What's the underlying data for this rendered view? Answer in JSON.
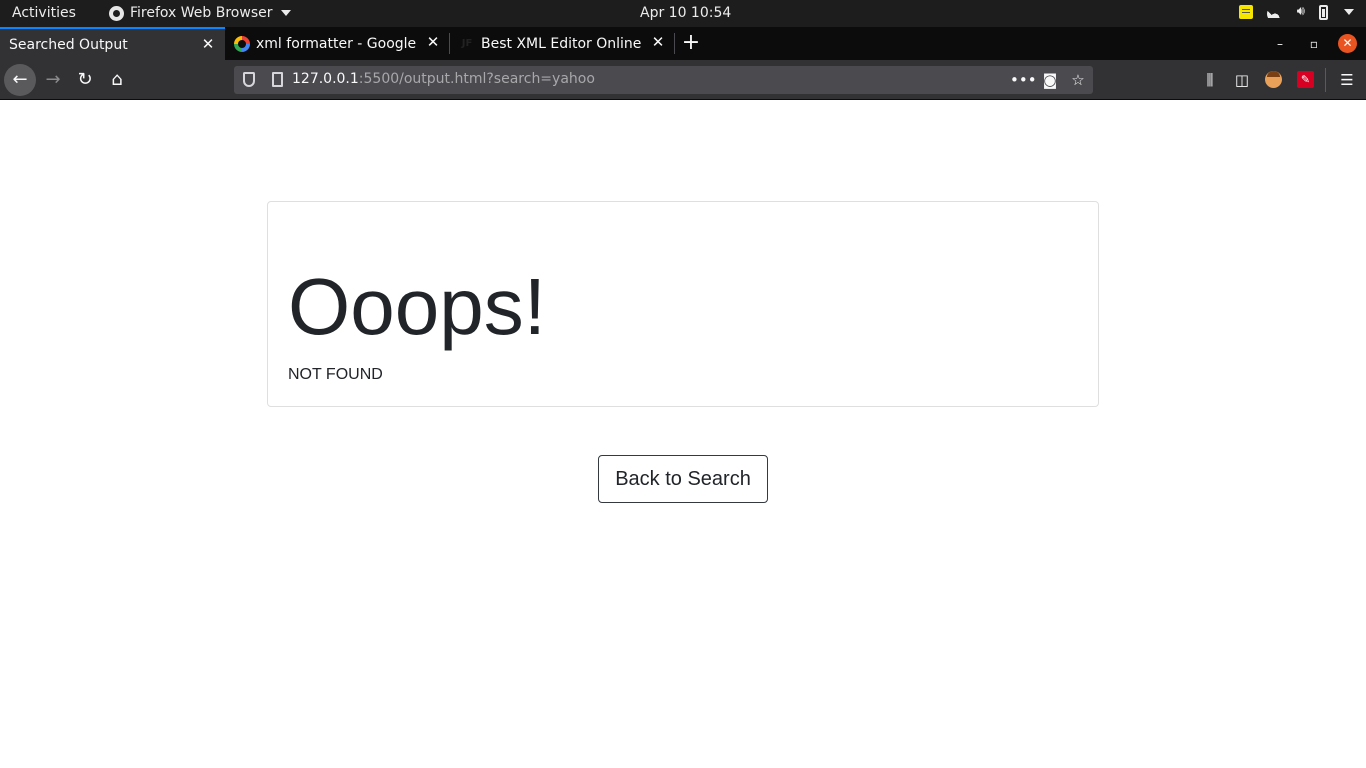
{
  "system_bar": {
    "activities": "Activities",
    "app_name": "Firefox Web Browser",
    "clock": "Apr 10  10:54"
  },
  "tabs": [
    {
      "label": "Searched Output",
      "active": true
    },
    {
      "label": "xml formatter - Google S",
      "active": false,
      "favicon": "google-favicon-icon"
    },
    {
      "label": "Best XML Editor Online",
      "active": false,
      "favicon": "jsonformatter-favicon-icon"
    }
  ],
  "navbar": {
    "url_host": "127.0.0.1",
    "url_rest": ":5500/output.html?search=yahoo"
  },
  "page": {
    "heading": "Ooops!",
    "message": "NOT FOUND",
    "back_button": "Back to Search"
  },
  "colors": {
    "accent_tab": "#0a84ff",
    "close_window": "#e95420",
    "text": "#212529"
  }
}
